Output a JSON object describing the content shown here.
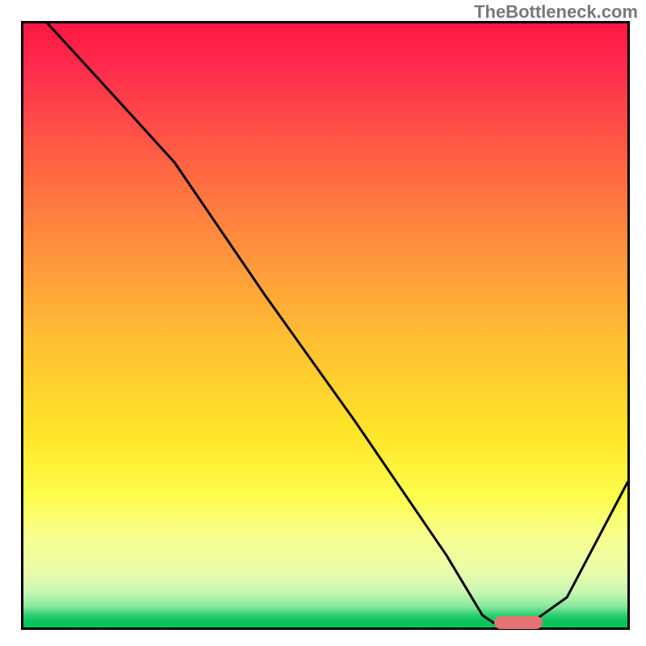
{
  "watermark": "TheBottleneck.com",
  "chart_data": {
    "type": "line",
    "title": "",
    "xlabel": "",
    "ylabel": "",
    "xlim": [
      0,
      100
    ],
    "ylim": [
      0,
      100
    ],
    "x": [
      4,
      15,
      25,
      40,
      55,
      70,
      76,
      79,
      83,
      90,
      100
    ],
    "values": [
      100,
      88,
      77,
      55,
      34,
      12,
      2,
      0,
      0,
      5,
      24
    ],
    "marker": {
      "x_start": 78,
      "x_end": 86,
      "y": 0.8
    },
    "color_scale_note": "background vertical gradient red→yellow→green"
  }
}
